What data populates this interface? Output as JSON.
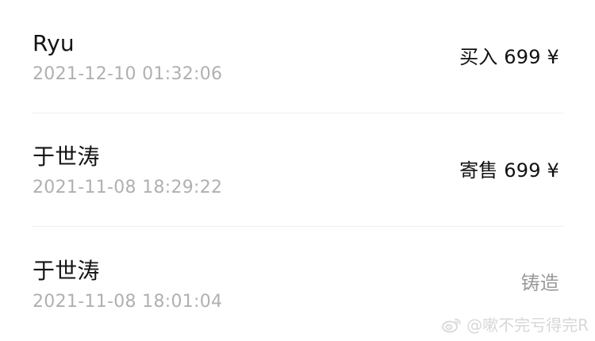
{
  "transactions": [
    {
      "name": "Ryu",
      "time": "2021-12-10 01:32:06",
      "action": "买入 699 ¥"
    },
    {
      "name": "于世涛",
      "time": "2021-11-08 18:29:22",
      "action": "寄售 699 ¥"
    },
    {
      "name": "于世涛",
      "time": "2021-11-08 18:01:04",
      "action": "铸造"
    }
  ],
  "watermark": {
    "text": "@嗽不完亏得完R",
    "icon": "weibo-icon"
  },
  "colors": {
    "primary_text": "#141414",
    "secondary_text": "#b0b0b0",
    "muted_action": "#9a9a9a",
    "divider": "#eeeeee",
    "watermark": "#d3d3d3"
  }
}
